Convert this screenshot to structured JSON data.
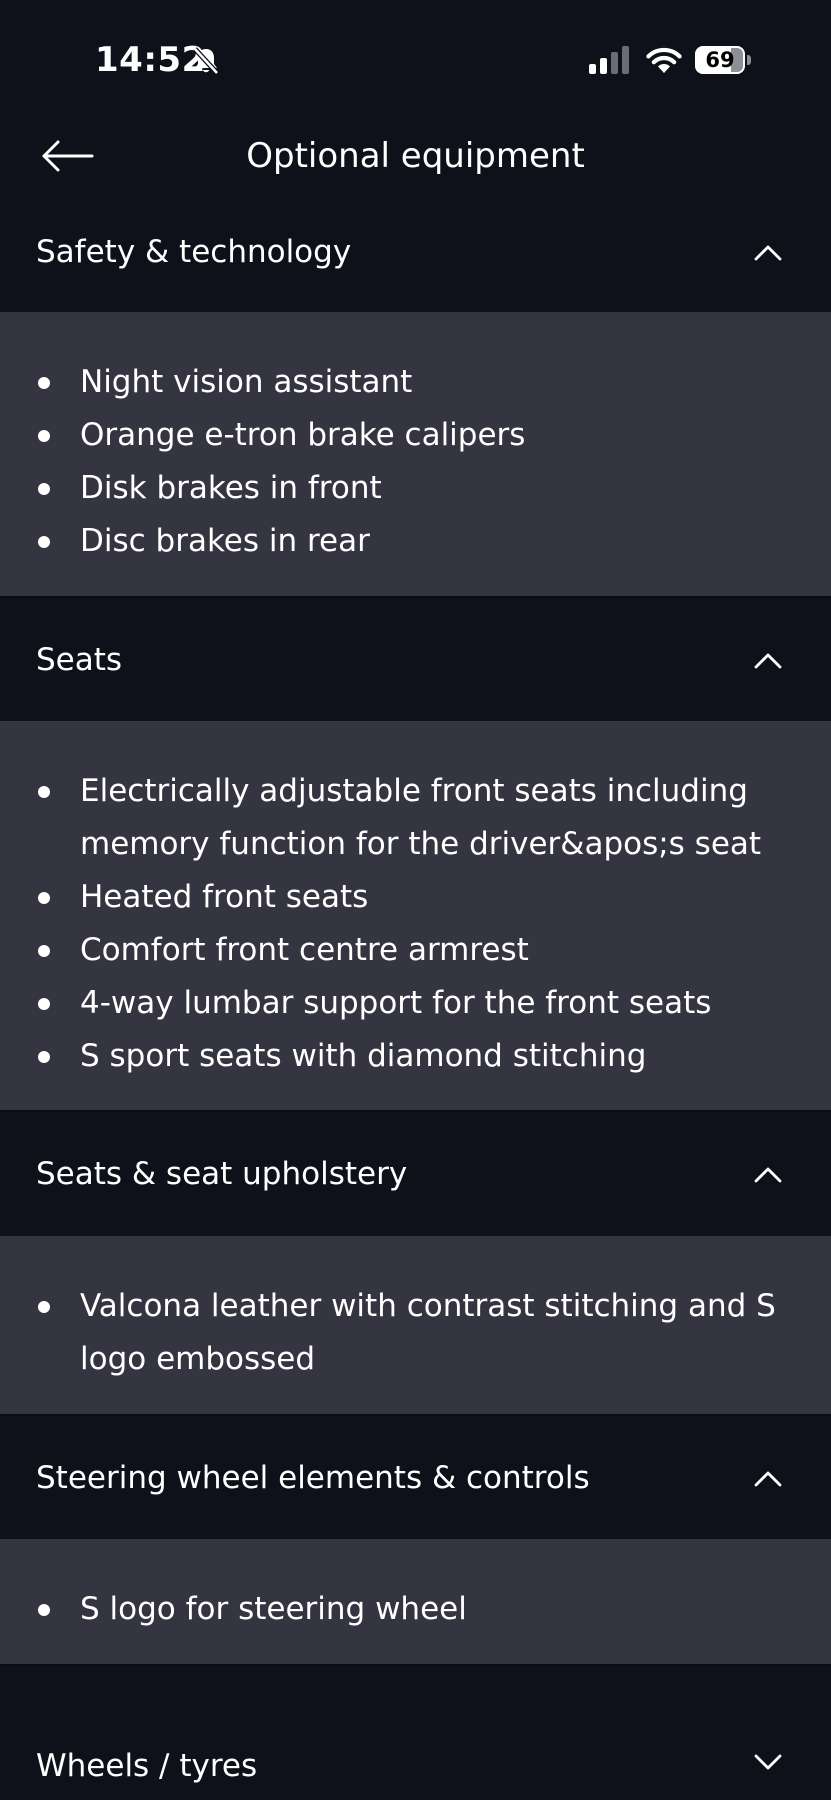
{
  "status_bar": {
    "time": "14:52",
    "battery": "69",
    "icons": [
      "bell-slash-icon",
      "cellular-signal-icon",
      "wifi-icon",
      "battery-icon"
    ]
  },
  "header": {
    "title": "Optional equipment",
    "back_icon": "arrow-left-icon"
  },
  "sections": [
    {
      "label": "Safety & technology",
      "expanded": true,
      "items": [
        "Night vision assistant",
        "Orange e-tron brake calipers",
        "Disk brakes in front",
        "Disc brakes in rear"
      ]
    },
    {
      "label": "Seats",
      "expanded": true,
      "items": [
        "Electrically adjustable front seats including memory function for the driver&apos;s seat",
        "Heated front seats",
        "Comfort front centre armrest",
        "4-way lumbar support for the front seats",
        "S sport seats with diamond stitching"
      ]
    },
    {
      "label": "Seats & seat upholstery",
      "expanded": true,
      "items": [
        "Valcona leather with contrast stitching and S logo embossed"
      ]
    },
    {
      "label": "Steering wheel elements & controls",
      "expanded": true,
      "items": [
        "S logo for steering wheel"
      ]
    },
    {
      "label": "Wheels / tyres",
      "expanded": false,
      "items": []
    }
  ],
  "colors": {
    "background": "#0e1119",
    "expanded_panel": "#343540",
    "text": "#ffffff"
  }
}
